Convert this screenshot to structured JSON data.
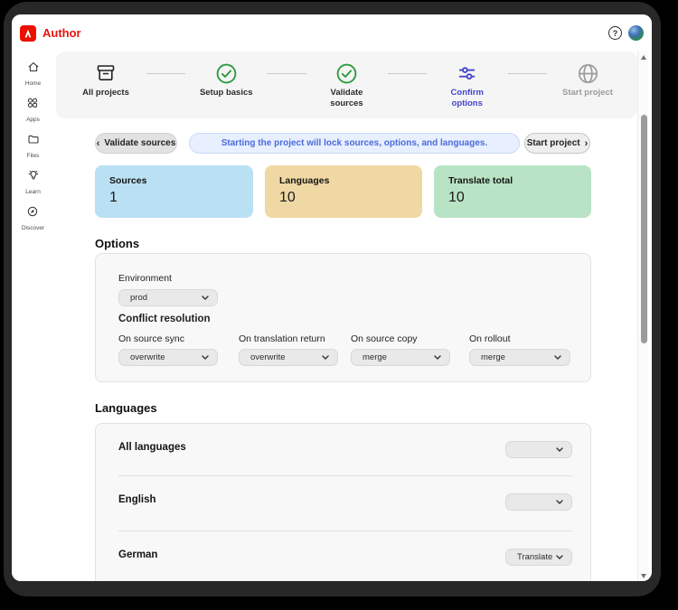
{
  "app": {
    "title": "Author",
    "brand_color": "#EB1000",
    "help_icon": "?"
  },
  "sidebar": {
    "items": [
      {
        "label": "Home",
        "icon": "home-icon"
      },
      {
        "label": "Apps",
        "icon": "apps-icon"
      },
      {
        "label": "Files",
        "icon": "files-icon"
      },
      {
        "label": "Learn",
        "icon": "learn-icon"
      },
      {
        "label": "Discover",
        "icon": "discover-icon"
      }
    ]
  },
  "stepper": {
    "steps": [
      {
        "label": "All projects",
        "icon": "archive-box-icon",
        "state": "default"
      },
      {
        "label": "Setup basics",
        "icon": "check-circle-icon",
        "state": "complete"
      },
      {
        "label": "Validate sources",
        "icon": "check-circle-icon",
        "state": "complete"
      },
      {
        "label": "Confirm options",
        "icon": "sliders-icon",
        "state": "current"
      },
      {
        "label": "Start project",
        "icon": "globe-icon",
        "state": "upcoming"
      }
    ],
    "complete_color": "#2B9A3E",
    "current_color": "#4444CE",
    "upcoming_color": "#9B9B9B"
  },
  "actions": {
    "back_chevron": "‹",
    "back_label": "Validate sources",
    "banner_text": "Starting the project will lock sources, options, and languages.",
    "next_label": "Start project",
    "next_chevron": "›"
  },
  "summary_cards": [
    {
      "label": "Sources",
      "value": "1",
      "bg": "#BAE0F4"
    },
    {
      "label": "Languages",
      "value": "10",
      "bg": "#F0D8A4"
    },
    {
      "label": "Translate total",
      "value": "10",
      "bg": "#B8E3C4"
    }
  ],
  "options": {
    "heading": "Options",
    "environment_label": "Environment",
    "environment_value": "prod",
    "conflict_heading": "Conflict resolution",
    "fields": [
      {
        "label": "On source sync",
        "value": "overwrite"
      },
      {
        "label": "On translation return",
        "value": "overwrite"
      },
      {
        "label": "On source copy",
        "value": "merge"
      },
      {
        "label": "On rollout",
        "value": "merge"
      }
    ]
  },
  "languages": {
    "heading": "Languages",
    "rows": [
      {
        "name": "All languages",
        "value": ""
      },
      {
        "name": "English",
        "value": ""
      },
      {
        "name": "German",
        "value": "Translate"
      }
    ]
  }
}
